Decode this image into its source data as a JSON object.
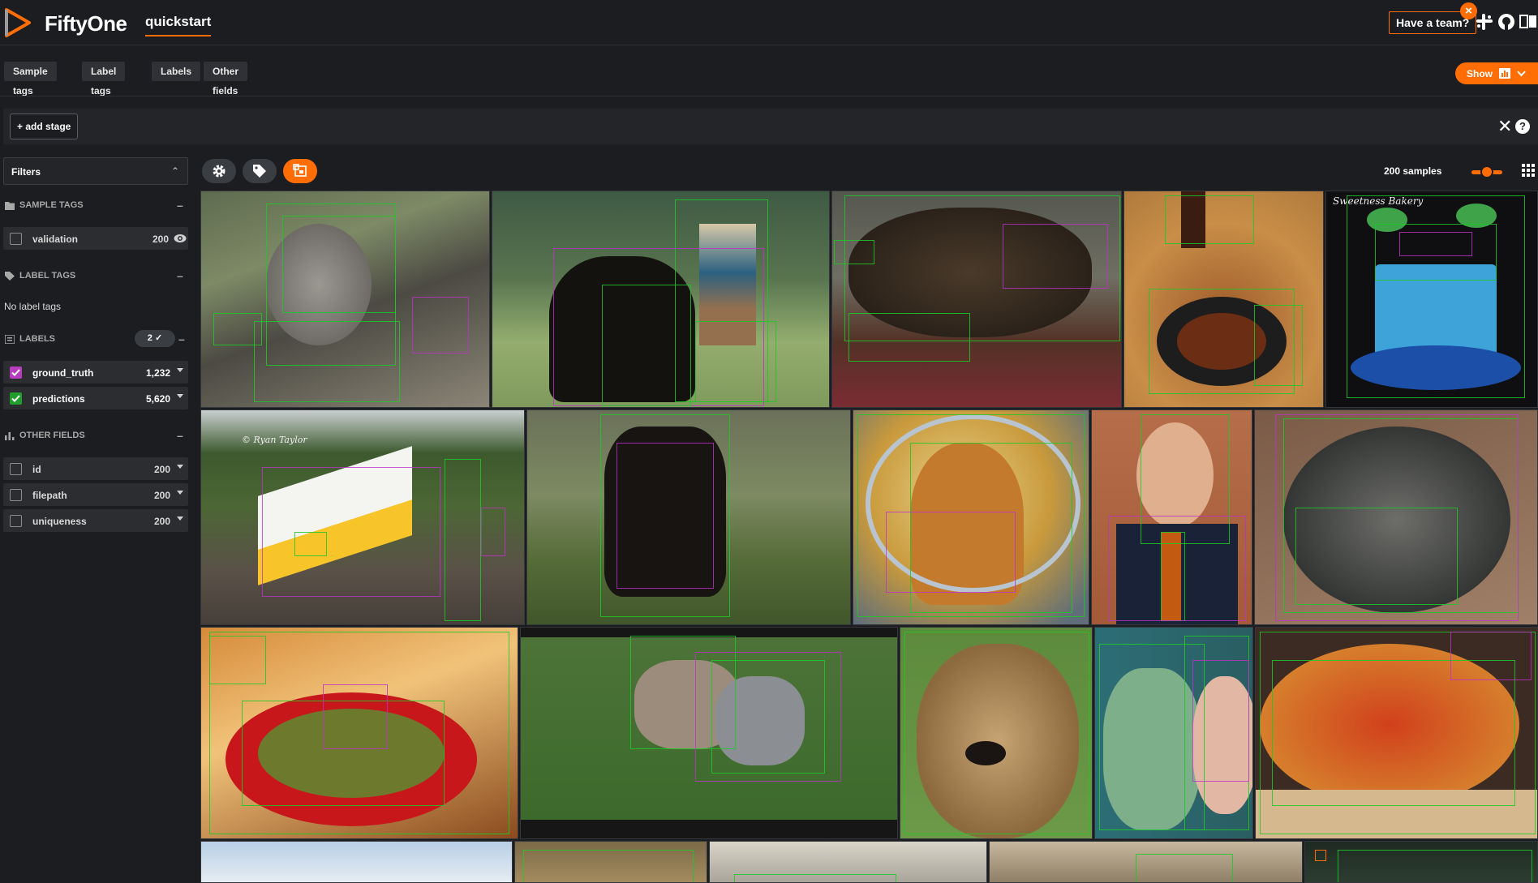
{
  "header": {
    "app_name": "FiftyOne",
    "dataset_name": "quickstart",
    "team_button": "Have a team?",
    "icons": [
      "slack-icon",
      "github-icon",
      "docs-icon"
    ]
  },
  "field_tabs": [
    "Sample tags",
    "Label tags",
    "Labels",
    "Other fields"
  ],
  "show_button": "Show",
  "view_bar": {
    "add_stage": "+ add stage"
  },
  "sidebar": {
    "filters_title": "Filters",
    "sample_tags": {
      "title": "SAMPLE TAGS",
      "items": [
        {
          "name": "validation",
          "count": "200"
        }
      ]
    },
    "label_tags": {
      "title": "LABEL TAGS",
      "empty_text": "No label tags"
    },
    "labels": {
      "title": "LABELS",
      "badge": "2 ✓",
      "items": [
        {
          "name": "ground_truth",
          "count": "1,232",
          "color": "#b73dbf"
        },
        {
          "name": "predictions",
          "count": "5,620",
          "color": "#1f9e2c"
        }
      ]
    },
    "other_fields": {
      "title": "OTHER FIELDS",
      "items": [
        {
          "name": "id",
          "count": "200"
        },
        {
          "name": "filepath",
          "count": "200"
        },
        {
          "name": "uniqueness",
          "count": "200"
        }
      ]
    }
  },
  "grid": {
    "samples_count": "200 samples",
    "watermarks": {
      "train": "© Ryan Taylor",
      "cake": "Sweetness Bakery"
    }
  },
  "colors": {
    "accent": "#ff6d04",
    "background": "#1b1d20",
    "panel": "#2b2d31"
  }
}
